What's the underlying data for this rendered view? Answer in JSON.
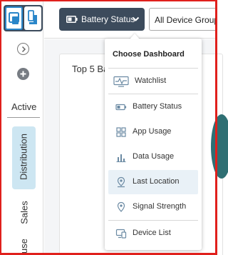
{
  "sidebar": {
    "logo": "device-dashboard-logo",
    "expand_icon": "chevron-right-icon",
    "add_icon": "plus-icon",
    "section_label": "Active",
    "tabs": [
      {
        "label": "Distribution",
        "selected": true
      },
      {
        "label": "Sales",
        "selected": false
      },
      {
        "label": "use",
        "selected": false
      }
    ]
  },
  "toolbar": {
    "dashboard_button_label": "Battery Status",
    "dashboard_button_icon": "battery-icon",
    "group_select_value": "All Device Groups"
  },
  "card": {
    "title": "Top 5 Ba"
  },
  "menu": {
    "header": "Choose Dashboard",
    "items": [
      {
        "label": "Watchlist",
        "icon": "watchlist-icon"
      },
      {
        "label": "Battery Status",
        "icon": "battery-icon"
      },
      {
        "label": "App Usage",
        "icon": "app-grid-icon"
      },
      {
        "label": "Data Usage",
        "icon": "bar-chart-icon"
      },
      {
        "label": "Last Location",
        "icon": "location-pin-icon",
        "highlighted": true
      },
      {
        "label": "Signal Strength",
        "icon": "signal-pin-icon"
      },
      {
        "label": "Device List",
        "icon": "device-list-icon"
      }
    ]
  },
  "colors": {
    "accent_dark": "#3c4b5c",
    "accent_blue": "#2a86c9",
    "tab_selected_bg": "#cde6f2",
    "menu_highlight": "#e9f1f7",
    "frame_red": "#e0201c"
  }
}
